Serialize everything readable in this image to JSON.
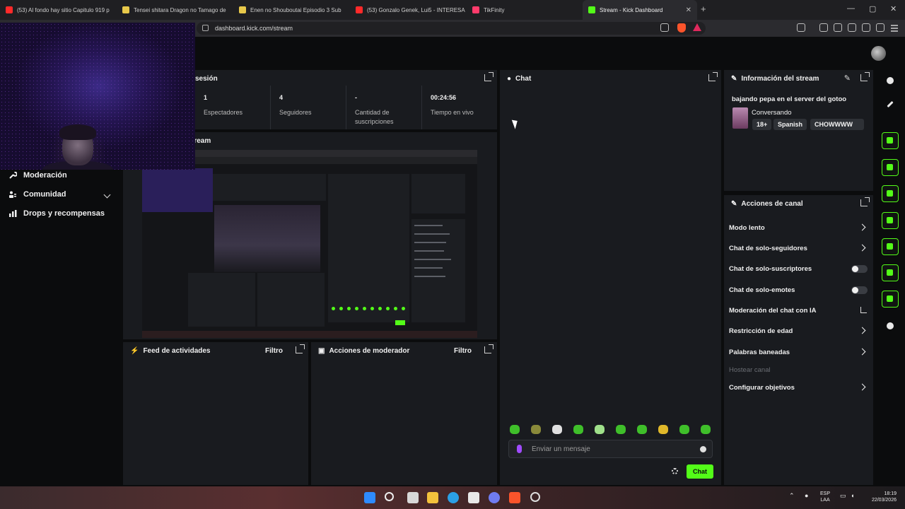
{
  "browser": {
    "tabs": [
      {
        "title": "(53) Al fondo hay sitio Capitulo 919 p",
        "favicon_color": "#ff2a2a"
      },
      {
        "title": "Tensei shitara Dragon no Tamago de",
        "favicon_color": "#e7c84a"
      },
      {
        "title": "Enen no Shouboutai Episodio 3 Sub",
        "favicon_color": "#e7c84a"
      },
      {
        "title": "(53) Gonzalo Genek, Lui5 - INTERESA",
        "favicon_color": "#ff2a2a"
      },
      {
        "title": "TikFinity",
        "favicon_color": "#ff3b6b"
      },
      {
        "title": "Stream - Kick Dashboard",
        "favicon_color": "#53fc18"
      }
    ],
    "new_tab": "+",
    "url": "dashboard.kick.com/stream"
  },
  "session": {
    "title_partial": "sesión",
    "stats": [
      {
        "value": "1",
        "label": "Espectadores"
      },
      {
        "value": "4",
        "label": "Seguidores"
      },
      {
        "value": "-",
        "label": "Cantidad de suscripciones"
      },
      {
        "value": "00:24:56",
        "label": "Tiempo en vivo"
      }
    ]
  },
  "stream_preview": {
    "title_partial": "tream"
  },
  "sidebar": {
    "items": [
      {
        "label": "Moderación",
        "icon": "wrench-icon"
      },
      {
        "label": "Comunidad",
        "icon": "users-icon"
      },
      {
        "label": "Drops y recompensas",
        "icon": "chart-icon"
      }
    ]
  },
  "activity_feed": {
    "title": "Feed de actividades",
    "filter": "Filtro"
  },
  "mod_actions": {
    "title": "Acciones de moderador",
    "filter": "Filtro"
  },
  "chat": {
    "title": "Chat",
    "input_placeholder": "Enviar un mensaje",
    "send_label": "Chat"
  },
  "stream_info": {
    "title": "Información del stream",
    "stream_title": "bajando pepa en el server del gotoo",
    "category": "Conversando",
    "tags": [
      "18+",
      "Spanish",
      "CHOWWWW"
    ]
  },
  "channel_actions": {
    "title": "Acciones de canal",
    "items": [
      {
        "label": "Modo lento",
        "control": "arrow"
      },
      {
        "label": "Chat de solo-seguidores",
        "control": "arrow"
      },
      {
        "label": "Chat de solo-suscriptores",
        "control": "toggle",
        "on": false
      },
      {
        "label": "Chat de solo-emotes",
        "control": "toggle",
        "on": false
      },
      {
        "label": "Moderación del chat con IA",
        "control": "external"
      },
      {
        "label": "Restricción de edad",
        "control": "arrow"
      },
      {
        "label": "Palabras baneadas",
        "control": "arrow"
      },
      {
        "label": "Hostear canal",
        "control": "none",
        "disabled": true
      },
      {
        "label": "Configurar objetivos",
        "control": "arrow"
      }
    ]
  },
  "taskbar": {
    "lang_top": "ESP",
    "lang_bottom": "LAA",
    "time": "18:19",
    "date": "22/03/2026"
  },
  "colors": {
    "accent": "#53fc18",
    "panel": "#191b1f",
    "background": "#0b0c0d"
  }
}
